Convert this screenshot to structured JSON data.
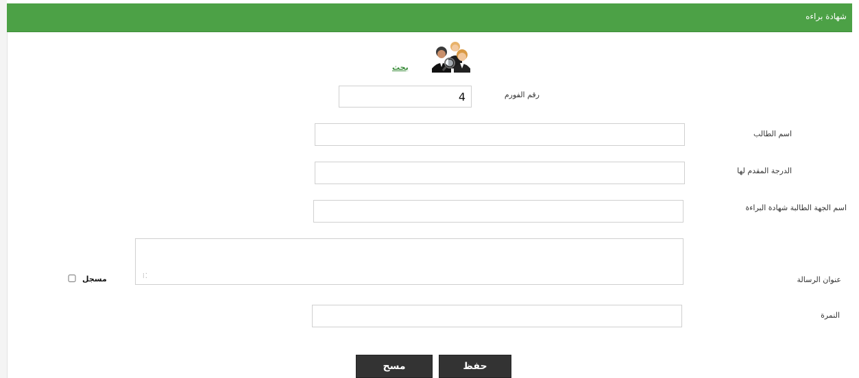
{
  "header": {
    "title": "شهادة براءه",
    "color": "#4ca146"
  },
  "search": {
    "link_label": "بحث",
    "icon": "users-group-icon"
  },
  "form": {
    "form_no": {
      "label": "رقم الفورم",
      "value": "4"
    },
    "student_name": {
      "label": "اسم الطالب",
      "value": ""
    },
    "degree": {
      "label": "الدرجة المقدم لها",
      "value": ""
    },
    "requesting_party": {
      "label": "اسم الجهة الطالبة شهادة البراءة",
      "value": ""
    },
    "thesis_title": {
      "label": "عنوان الرسالة",
      "value": ""
    },
    "registered": {
      "label": "مسجل",
      "checked": false
    },
    "grade": {
      "label": "النمرة",
      "value": ""
    }
  },
  "actions": {
    "save_label": "حفظ",
    "clear_label": "مسح"
  }
}
